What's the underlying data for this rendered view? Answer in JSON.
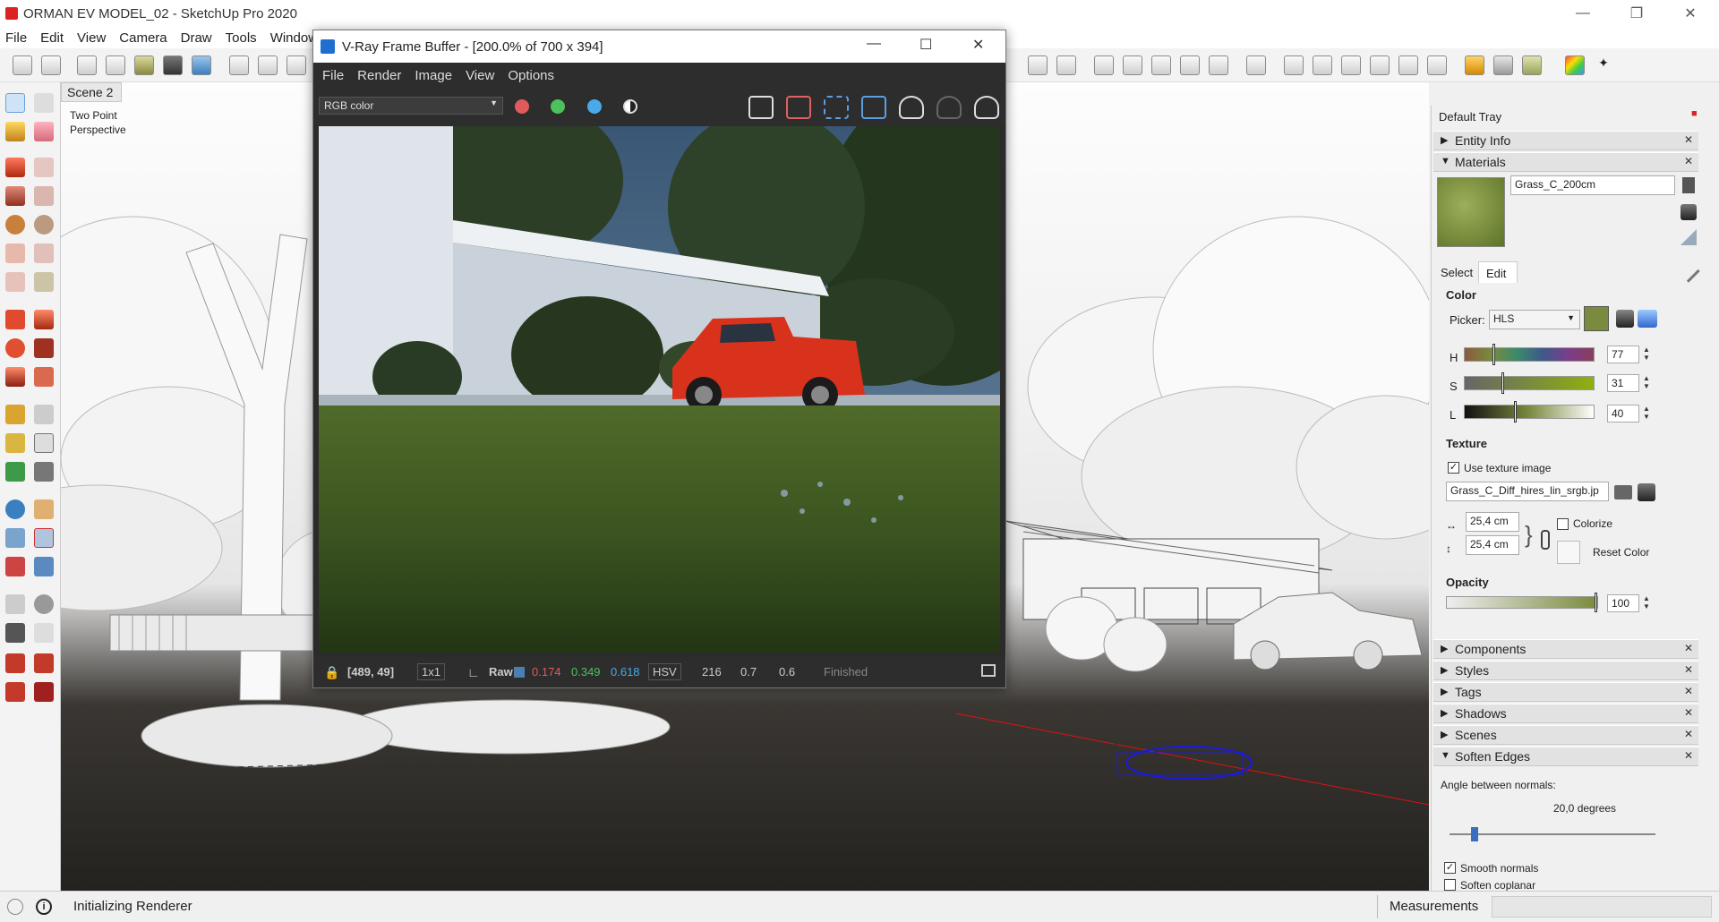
{
  "window": {
    "title": "ORMAN EV MODEL_02 - SketchUp Pro 2020"
  },
  "menu": [
    "File",
    "Edit",
    "View",
    "Camera",
    "Draw",
    "Tools",
    "Window"
  ],
  "viewport": {
    "scene_tab": "Scene 2",
    "camera_line1": "Two Point",
    "camera_line2": "Perspective"
  },
  "vray": {
    "title": "V-Ray Frame Buffer - [200.0% of 700 x 394]",
    "menu": [
      "File",
      "Render",
      "Image",
      "View",
      "Options"
    ],
    "channel": "RGB color",
    "status": {
      "coords": "[489, 49]",
      "zoom": "1x1",
      "raw": "Raw",
      "r": "0.174",
      "g": "0.349",
      "b": "0.618",
      "mode": "HSV",
      "h": "216",
      "s": "0.7",
      "v": "0.6",
      "state": "Finished"
    },
    "colors": {
      "r": "#e05b5b",
      "g": "#4cc25a",
      "b": "#4aa9e8"
    }
  },
  "tray": {
    "title": "Default Tray",
    "entity_info": "Entity Info",
    "materials": "Materials",
    "material_name": "Grass_C_200cm",
    "tabs": [
      "Select",
      "Edit"
    ],
    "color_label": "Color",
    "picker_label": "Picker:",
    "picker_value": "HLS",
    "h_label": "H",
    "h_value": "77",
    "s_label": "S",
    "s_value": "31",
    "l_label": "L",
    "l_value": "40",
    "texture_label": "Texture",
    "use_texture": "Use texture image",
    "texture_file": "Grass_C_Diff_hires_lin_srgb.jp",
    "width": "25,4 cm",
    "height": "25,4 cm",
    "colorize": "Colorize",
    "reset_color": "Reset Color",
    "opacity_label": "Opacity",
    "opacity_value": "100",
    "components": "Components",
    "styles": "Styles",
    "tags": "Tags",
    "shadows": "Shadows",
    "scenes": "Scenes",
    "soften_edges": "Soften Edges",
    "angle_label": "Angle between normals:",
    "angle_value": "20,0  degrees",
    "smooth_normals": "Smooth normals",
    "soften_coplanar": "Soften coplanar",
    "material_color": "#7a8a3e"
  },
  "status": {
    "message": "Initializing Renderer",
    "measurements": "Measurements"
  }
}
